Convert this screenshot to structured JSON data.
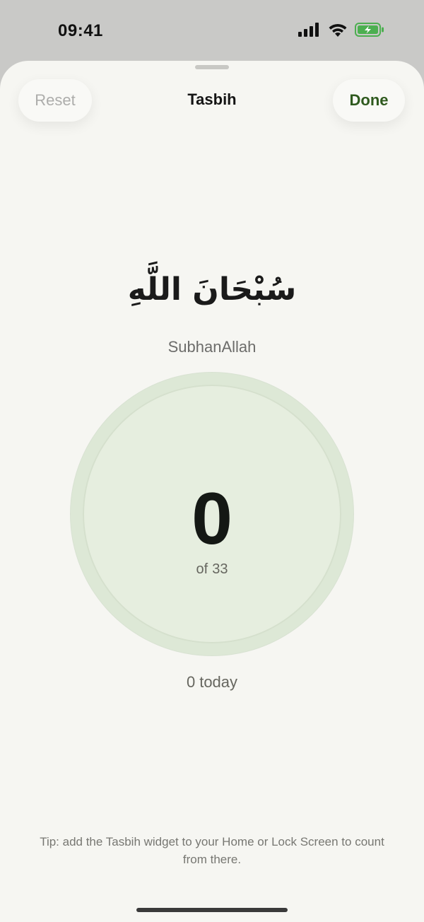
{
  "status_bar": {
    "time": "09:41",
    "signal_icon": "cellular-signal-icon",
    "wifi_icon": "wifi-icon",
    "battery_icon": "battery-charging-icon"
  },
  "header": {
    "title": "Tasbih",
    "reset_label": "Reset",
    "done_label": "Done"
  },
  "dhikr": {
    "arabic": "سُبْحَانَ اللَّهِ",
    "transliteration": "SubhanAllah"
  },
  "counter": {
    "count": "0",
    "target_prefix": "of",
    "target": "33"
  },
  "today": {
    "count": "0",
    "label": "today"
  },
  "tip": "Tip: add the Tasbih widget to your Home or Lock Screen to count from there.",
  "colors": {
    "accent": "#2f5a1e",
    "sheet_background": "#f6f6f2",
    "counter_ring": "#dde8d6",
    "counter_fill": "#e6eedf"
  }
}
